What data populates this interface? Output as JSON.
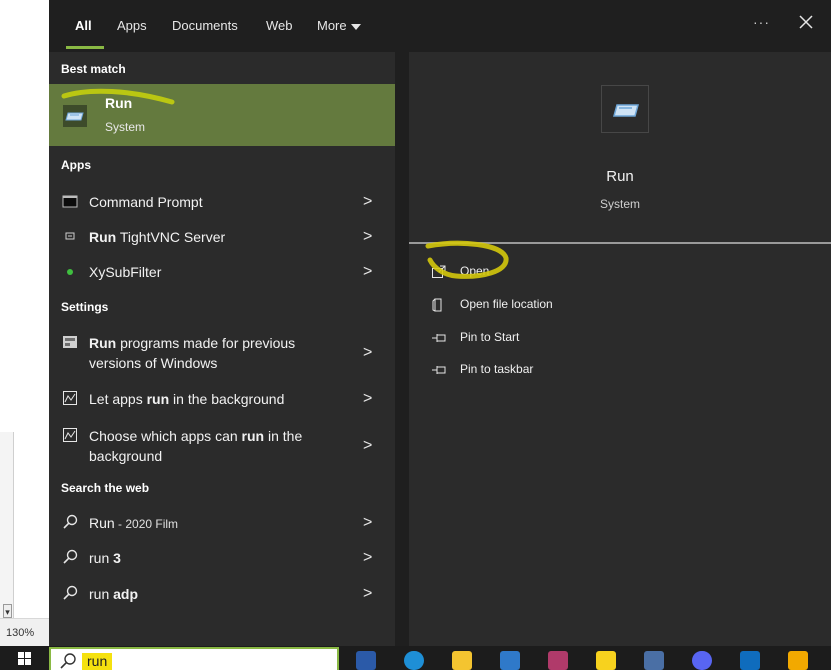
{
  "background_app": {
    "zoom_level": "130%"
  },
  "tabs": [
    {
      "label": "All"
    },
    {
      "label": "Apps"
    },
    {
      "label": "Documents"
    },
    {
      "label": "Web"
    },
    {
      "label": "More"
    }
  ],
  "header": {
    "more_options": "···",
    "close": "✕"
  },
  "sections": {
    "best_match": "Best match",
    "apps": "Apps",
    "settings": "Settings",
    "search_web": "Search the web"
  },
  "best_match": {
    "title": "Run",
    "subtitle": "System"
  },
  "apps": [
    {
      "label": "Command Prompt",
      "icon": "command-prompt-icon"
    },
    {
      "bold": "Run",
      "rest": " TightVNC Server",
      "icon": "tightvnc-icon"
    },
    {
      "label": "XySubFilter",
      "icon": "xysubfilter-icon"
    }
  ],
  "settings": [
    {
      "line1_bold": "Run",
      "line1_rest": " programs made for previous",
      "line2": "versions of Windows",
      "icon": "compatibility-icon"
    },
    {
      "pre": "Let apps ",
      "bold": "run",
      "post": " in the background",
      "icon": "background-apps-icon"
    },
    {
      "line1_pre": "Choose which apps can ",
      "line1_bold": "run",
      "line1_post": " in the",
      "line2": "background",
      "icon": "background-apps-icon"
    }
  ],
  "web": [
    {
      "main": "Run",
      "suffix": " - 2020 Film"
    },
    {
      "pre": "run ",
      "bold": "3"
    },
    {
      "pre": "run ",
      "bold": "adp"
    }
  ],
  "details": {
    "title": "Run",
    "subtitle": "System",
    "actions": [
      {
        "label": "Open",
        "icon": "open-icon"
      },
      {
        "label": "Open file location",
        "icon": "file-location-icon"
      },
      {
        "label": "Pin to Start",
        "icon": "pin-icon"
      },
      {
        "label": "Pin to taskbar",
        "icon": "pin-icon"
      }
    ]
  },
  "search": {
    "query": "run"
  },
  "taskbar_icons": [
    "powershell-icon",
    "edge-icon",
    "file-explorer-icon",
    "vscode-icon",
    "paint-icon",
    "sticky-notes-icon",
    "network-icon",
    "discord-icon",
    "outlook-icon",
    "pin-tool-icon"
  ],
  "colors": {
    "accent": "#8ab944",
    "selected_bg": "#647a3e",
    "panel_bg": "#2b2b2b",
    "highlight": "#f5e10f"
  }
}
